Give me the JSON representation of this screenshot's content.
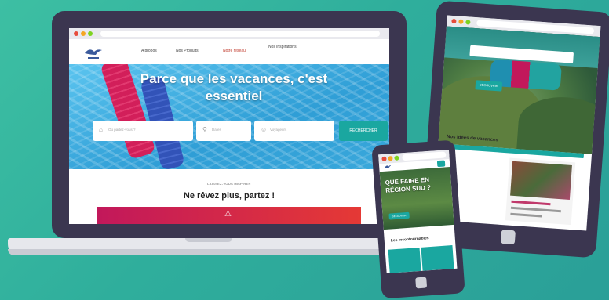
{
  "laptop": {
    "nav": {
      "about": "A propos",
      "products": "Nos Produits",
      "network": "Notre réseau",
      "inspirations": "Nos inspirations"
    },
    "hero_title": "Parce que les vacances, c'est essentiel",
    "search": {
      "destination_placeholder": "Où partez-vous ?",
      "dates_placeholder": "Dates",
      "travelers_placeholder": "Voyageurs",
      "button": "RECHERCHER"
    },
    "section_kicker": "LAISSEZ-VOUS INSPIRER",
    "section_title": "Ne rêvez plus, partez !"
  },
  "tablet": {
    "button": "DÉCOUVRIR",
    "section_title": "Nos idées de vacances"
  },
  "phone": {
    "hero_title": "QUE FAIRE EN RÉGION SUD ?",
    "hero_button": "DÉCOUVRIR",
    "section_text": "Les incontournables"
  },
  "colors": {
    "background": "#3dbfa3",
    "device_frame": "#3b3650",
    "accent_teal": "#1aa7a0",
    "accent_pink": "#c2185b"
  }
}
